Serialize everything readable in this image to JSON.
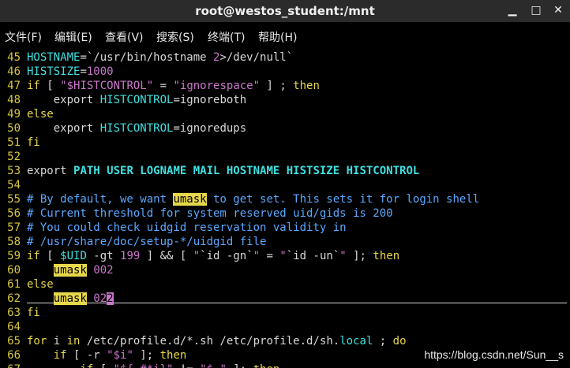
{
  "window": {
    "title": "root@westos_student:/mnt",
    "buttons": {
      "minimize": "▁",
      "maximize": "□",
      "close": "✕"
    }
  },
  "menu": [
    {
      "label": "文件(F)"
    },
    {
      "label": "编辑(E)"
    },
    {
      "label": "查看(V)"
    },
    {
      "label": "搜索(S)"
    },
    {
      "label": "终端(T)"
    },
    {
      "label": "帮助(H)"
    }
  ],
  "lines": [
    {
      "n": "45",
      "tokens": [
        [
          "v",
          "HOSTNAME"
        ],
        [
          "t",
          "=`/usr/bin/hostname "
        ],
        [
          "n",
          "2"
        ],
        [
          "t",
          ">/dev/null`"
        ]
      ]
    },
    {
      "n": "46",
      "tokens": [
        [
          "v",
          "HISTSIZE"
        ],
        [
          "t",
          "="
        ],
        [
          "n",
          "1000"
        ]
      ]
    },
    {
      "n": "47",
      "tokens": [
        [
          "k",
          "if"
        ],
        [
          "t",
          " [ "
        ],
        [
          "s",
          "\"$HISTCONTROL\""
        ],
        [
          "t",
          " = "
        ],
        [
          "s",
          "\"ignorespace\""
        ],
        [
          "t",
          " ] ; "
        ],
        [
          "k",
          "then"
        ]
      ]
    },
    {
      "n": "48",
      "tokens": [
        [
          "t",
          "    export "
        ],
        [
          "v",
          "HISTCONTROL"
        ],
        [
          "t",
          "=ignoreboth"
        ]
      ]
    },
    {
      "n": "49",
      "tokens": [
        [
          "k",
          "else"
        ]
      ]
    },
    {
      "n": "50",
      "tokens": [
        [
          "t",
          "    export "
        ],
        [
          "v",
          "HISTCONTROL"
        ],
        [
          "t",
          "=ignoredups"
        ]
      ]
    },
    {
      "n": "51",
      "tokens": [
        [
          "k",
          "fi"
        ]
      ]
    },
    {
      "n": "52",
      "tokens": []
    },
    {
      "n": "53",
      "tokens": [
        [
          "t",
          "export "
        ],
        [
          "b",
          "PATH USER LOGNAME MAIL HOSTNAME HISTSIZE HISTCONTROL"
        ]
      ]
    },
    {
      "n": "54",
      "tokens": []
    },
    {
      "n": "55",
      "tokens": [
        [
          "c",
          "# By default, we want "
        ],
        [
          "h",
          "umask"
        ],
        [
          "c",
          " to get set. This sets it for login shell"
        ]
      ]
    },
    {
      "n": "56",
      "tokens": [
        [
          "c",
          "# Current threshold for system reserved uid/gids is 200"
        ]
      ]
    },
    {
      "n": "57",
      "tokens": [
        [
          "c",
          "# You could check uidgid reservation validity in"
        ]
      ]
    },
    {
      "n": "58",
      "tokens": [
        [
          "c",
          "# /usr/share/doc/setup-*/uidgid file"
        ]
      ]
    },
    {
      "n": "59",
      "tokens": [
        [
          "k",
          "if"
        ],
        [
          "t",
          " [ "
        ],
        [
          "v",
          "$UID"
        ],
        [
          "t",
          " -gt "
        ],
        [
          "n",
          "199"
        ],
        [
          "t",
          " ] && [ "
        ],
        [
          "s",
          "\""
        ],
        [
          "t",
          "`id -gn`"
        ],
        [
          "s",
          "\""
        ],
        [
          "t",
          " = "
        ],
        [
          "s",
          "\""
        ],
        [
          "t",
          "`id -un`"
        ],
        [
          "s",
          "\""
        ],
        [
          "t",
          " ]; "
        ],
        [
          "k",
          "then"
        ]
      ]
    },
    {
      "n": "60",
      "tokens": [
        [
          "t",
          "    "
        ],
        [
          "h",
          "umask"
        ],
        [
          "t",
          " "
        ],
        [
          "n",
          "002"
        ]
      ]
    },
    {
      "n": "61",
      "tokens": [
        [
          "k",
          "else"
        ]
      ]
    },
    {
      "n": "62",
      "tokens": [
        [
          "t",
          "    "
        ],
        [
          "h",
          "umask"
        ],
        [
          "t",
          " "
        ],
        [
          "n",
          "02"
        ],
        [
          "x",
          "2"
        ]
      ]
    },
    {
      "n": "63",
      "tokens": [
        [
          "k",
          "fi"
        ]
      ]
    },
    {
      "n": "64",
      "tokens": []
    },
    {
      "n": "65",
      "tokens": [
        [
          "k",
          "for"
        ],
        [
          "t",
          " i "
        ],
        [
          "k",
          "in"
        ],
        [
          "t",
          " /etc/profile.d/*.sh /etc/profile.d/sh."
        ],
        [
          "v",
          "local"
        ],
        [
          "t",
          " ; "
        ],
        [
          "k",
          "do"
        ]
      ]
    },
    {
      "n": "66",
      "tokens": [
        [
          "t",
          "    "
        ],
        [
          "k",
          "if"
        ],
        [
          "t",
          " [ -r "
        ],
        [
          "s",
          "\"$i\""
        ],
        [
          "t",
          " ]; "
        ],
        [
          "k",
          "then"
        ]
      ]
    },
    {
      "n": "67",
      "tokens": [
        [
          "t",
          "        "
        ],
        [
          "k",
          "if"
        ],
        [
          "t",
          " [ "
        ],
        [
          "s",
          "\"${-#*i}\""
        ],
        [
          "t",
          " != "
        ],
        [
          "s",
          "\"$-\""
        ],
        [
          "t",
          " ]; "
        ],
        [
          "k",
          "then"
        ]
      ]
    }
  ],
  "watermark": "https://blog.csdn.net/Sun__s"
}
